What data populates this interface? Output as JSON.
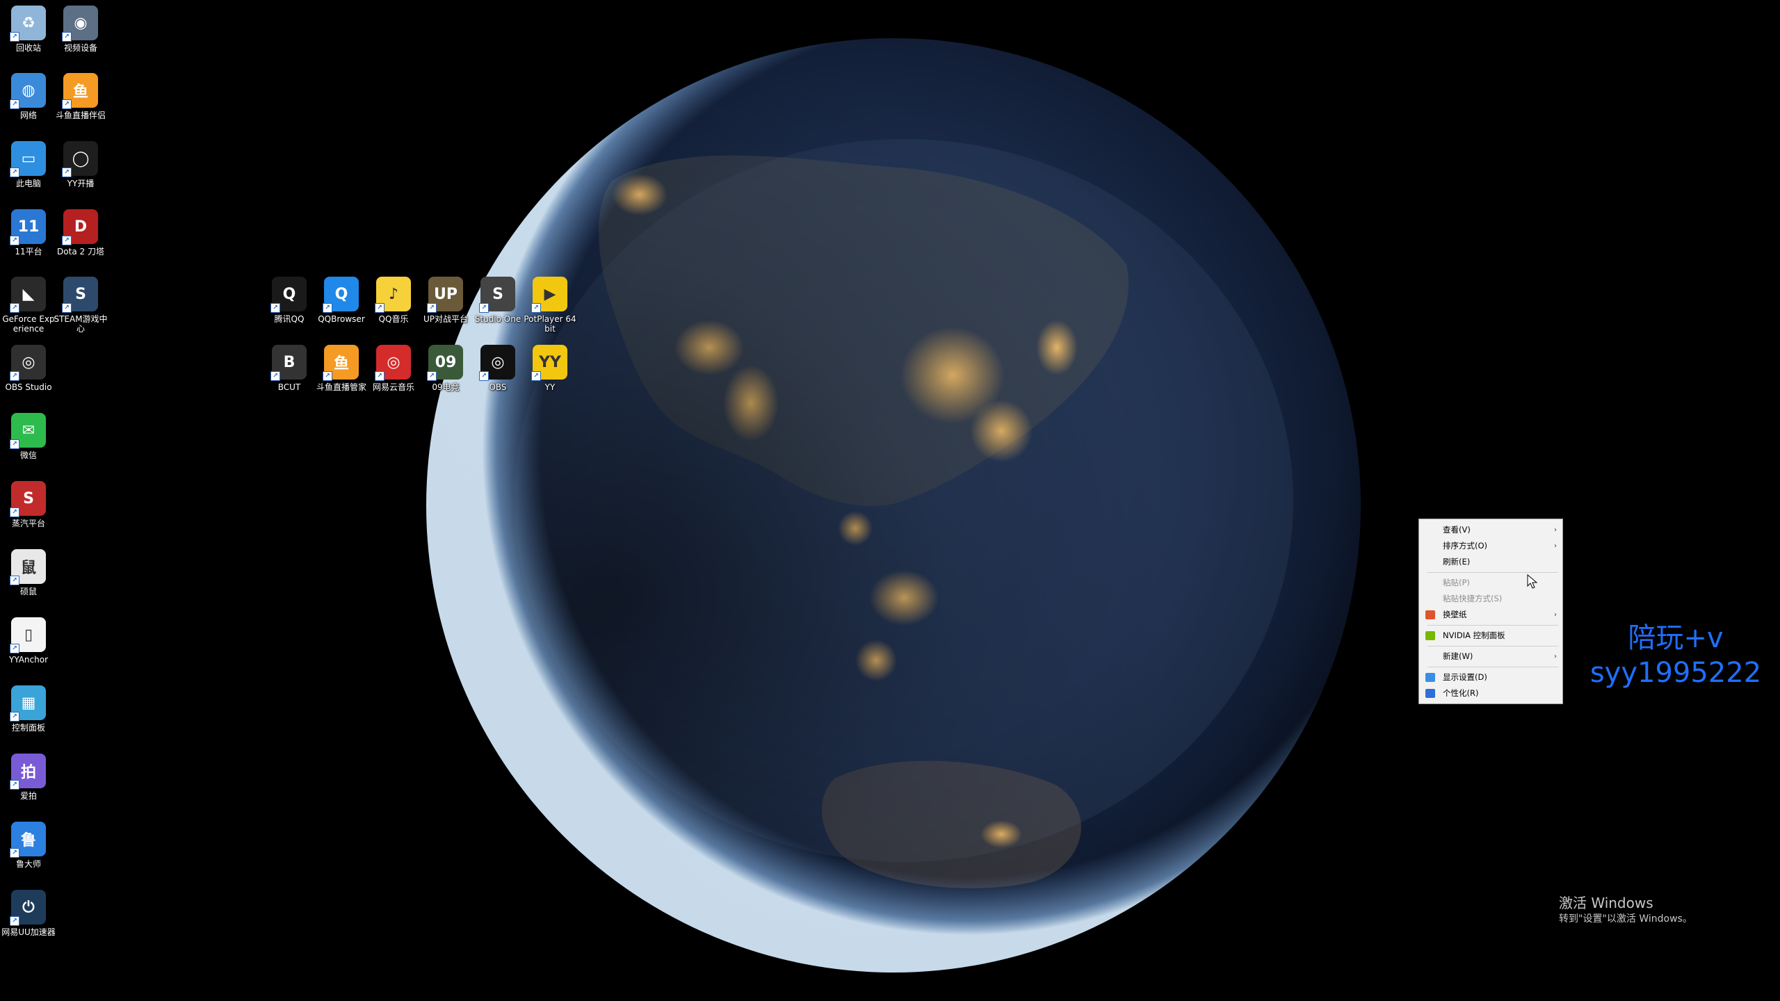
{
  "desktop": {
    "left_column": [
      {
        "label": "回收站",
        "icon": "recycle-bin-icon",
        "color": "#8fb6d8",
        "glyph": "♻"
      },
      {
        "label": "视频设备",
        "icon": "webcam-icon",
        "color": "#5c6f85",
        "glyph": "◉"
      },
      {
        "label": "网络",
        "icon": "network-icon",
        "color": "#3b8ad9",
        "glyph": "◍"
      },
      {
        "label": "斗鱼直播伴侣",
        "icon": "douyu-companion-icon",
        "color": "#f59a23",
        "glyph": "鱼"
      },
      {
        "label": "此电脑",
        "icon": "computer-icon",
        "color": "#2e8fe0",
        "glyph": "▭"
      },
      {
        "label": "YY开播",
        "icon": "yy-live-icon",
        "color": "#1e1e1e",
        "glyph": "◯"
      },
      {
        "label": "11平台",
        "icon": "11-platform-icon",
        "color": "#2b78d4",
        "glyph": "11"
      },
      {
        "label": "Dota 2 刀塔",
        "icon": "dota2-icon",
        "color": "#b52020",
        "glyph": "D"
      },
      {
        "label": "GeForce Experience",
        "icon": "geforce-icon",
        "color": "#2a2a2a",
        "glyph": "◣"
      },
      {
        "label": "STEAM游戏中心",
        "icon": "steam-game-center-icon",
        "color": "#2d4a6d",
        "glyph": "S"
      },
      {
        "label": "OBS Studio",
        "icon": "obs-studio-icon",
        "color": "#303030",
        "glyph": "◎"
      },
      {
        "label": "微信",
        "icon": "wechat-icon",
        "color": "#2dbb4e",
        "glyph": "✉"
      },
      {
        "label": "蒸汽平台",
        "icon": "steam-platform-icon",
        "color": "#c22b2b",
        "glyph": "S"
      },
      {
        "label": "硕鼠",
        "icon": "flvcd-icon",
        "color": "#e8e8e8",
        "glyph": "鼠"
      },
      {
        "label": "YYAnchor",
        "icon": "file-icon",
        "color": "#f4f4f4",
        "glyph": "▯"
      },
      {
        "label": "控制面板",
        "icon": "control-panel-icon",
        "color": "#3aa3d8",
        "glyph": "▦"
      },
      {
        "label": "爱拍",
        "icon": "aipai-icon",
        "color": "#7a5bd6",
        "glyph": "拍"
      },
      {
        "label": "鲁大师",
        "icon": "ludashi-icon",
        "color": "#2b80e0",
        "glyph": "鲁"
      },
      {
        "label": "网易UU加速器",
        "icon": "uu-booster-icon",
        "color": "#1e3c5a",
        "glyph": "⏻"
      }
    ],
    "center_grid": [
      {
        "label": "腾讯QQ",
        "icon": "qq-icon",
        "color": "#1a1a1a",
        "glyph": "Q"
      },
      {
        "label": "QQBrowser",
        "icon": "qq-browser-icon",
        "color": "#1f88e8",
        "glyph": "Q"
      },
      {
        "label": "QQ音乐",
        "icon": "qq-music-icon",
        "color": "#f7d13a",
        "glyph": "♪"
      },
      {
        "label": "UP对战平台",
        "icon": "up-battle-icon",
        "color": "#6a5a3a",
        "glyph": "UP"
      },
      {
        "label": "Studio One",
        "icon": "studio-one-icon",
        "color": "#444",
        "glyph": "S"
      },
      {
        "label": "PotPlayer 64 bit",
        "icon": "potplayer-icon",
        "color": "#f2c70f",
        "glyph": "▶"
      },
      {
        "label": "BCUT",
        "icon": "bcut-icon",
        "color": "#333",
        "glyph": "B"
      },
      {
        "label": "斗鱼直播管家",
        "icon": "douyu-manager-icon",
        "color": "#f59a23",
        "glyph": "鱼"
      },
      {
        "label": "网易云音乐",
        "icon": "netease-music-icon",
        "color": "#d42b2b",
        "glyph": "◎"
      },
      {
        "label": "09电竞",
        "icon": "09-esports-icon",
        "color": "#3a5a3a",
        "glyph": "09"
      },
      {
        "label": "OBS",
        "icon": "obs-icon",
        "color": "#111",
        "glyph": "◎"
      },
      {
        "label": "YY",
        "icon": "yy-icon",
        "color": "#f2c70f",
        "glyph": "YY"
      }
    ]
  },
  "context_menu": {
    "items": [
      {
        "label": "查看(V)",
        "submenu": true,
        "disabled": false,
        "sep_after": false,
        "icon": ""
      },
      {
        "label": "排序方式(O)",
        "submenu": true,
        "disabled": false,
        "sep_after": false,
        "icon": ""
      },
      {
        "label": "刷新(E)",
        "submenu": false,
        "disabled": false,
        "sep_after": true,
        "icon": ""
      },
      {
        "label": "粘贴(P)",
        "submenu": false,
        "disabled": true,
        "sep_after": false,
        "icon": ""
      },
      {
        "label": "粘贴快捷方式(S)",
        "submenu": false,
        "disabled": true,
        "sep_after": false,
        "icon": ""
      },
      {
        "label": "换壁纸",
        "submenu": true,
        "disabled": false,
        "sep_after": true,
        "icon": "wallpaper-icon"
      },
      {
        "label": "NVIDIA 控制面板",
        "submenu": false,
        "disabled": false,
        "sep_after": true,
        "icon": "nvidia-icon"
      },
      {
        "label": "新建(W)",
        "submenu": true,
        "disabled": false,
        "sep_after": true,
        "icon": ""
      },
      {
        "label": "显示设置(D)",
        "submenu": false,
        "disabled": false,
        "sep_after": false,
        "icon": "display-icon"
      },
      {
        "label": "个性化(R)",
        "submenu": false,
        "disabled": false,
        "sep_after": false,
        "icon": "personalize-icon"
      }
    ],
    "submenu_glyph": "›",
    "icon_colors": {
      "wallpaper-icon": "#e0542c",
      "nvidia-icon": "#76b900",
      "display-icon": "#3a8ee6",
      "personalize-icon": "#2f6ed8"
    }
  },
  "overlay": {
    "promo_line1": "陪玩+v",
    "promo_line2": "syy1995222",
    "activation_line1": "激活 Windows",
    "activation_line2": "转到\"设置\"以激活 Windows。"
  },
  "colors": {
    "promo": "#1f6fff",
    "menu_bg": "#f2f2f2"
  }
}
